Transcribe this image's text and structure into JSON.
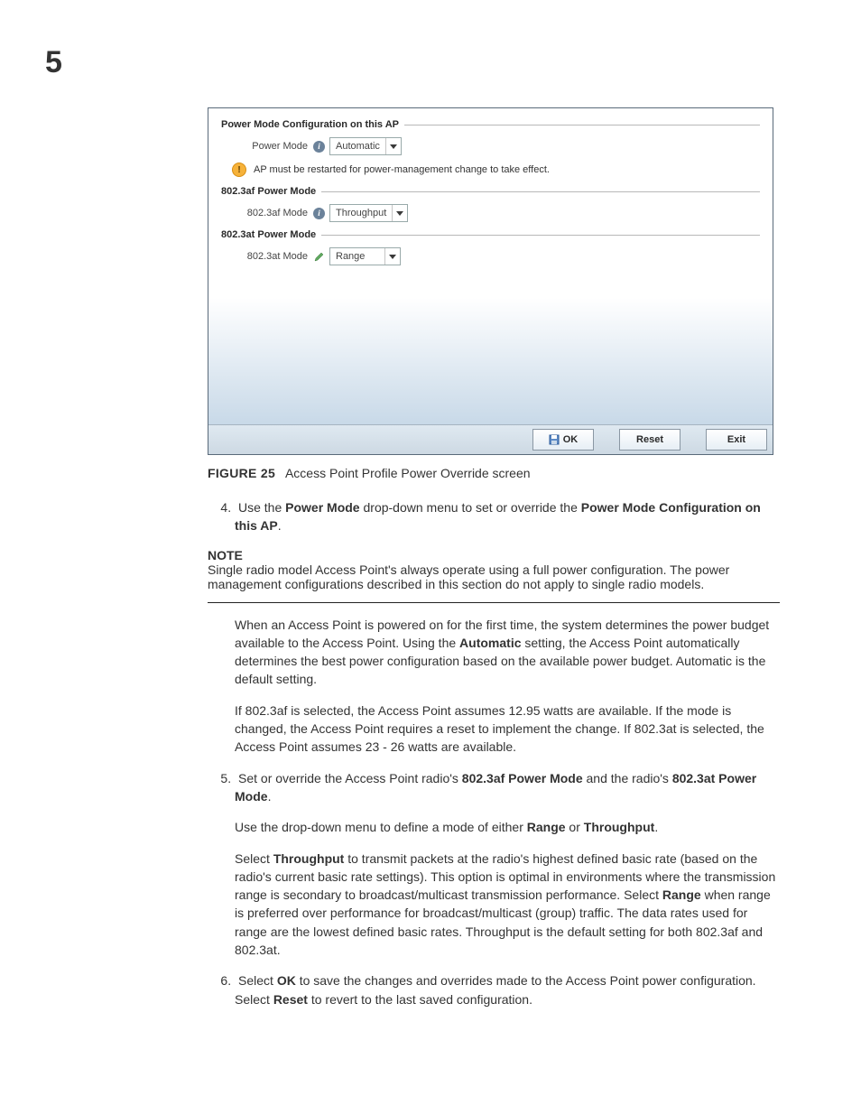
{
  "chapter_number": "5",
  "screenshot": {
    "section1": {
      "title": "Power Mode Configuration on this AP",
      "row_label": "Power Mode",
      "dropdown_value": "Automatic",
      "warning_text": "AP must be restarted for power-management change to take effect."
    },
    "section2": {
      "title": "802.3af Power Mode",
      "row_label": "802.3af Mode",
      "dropdown_value": "Throughput"
    },
    "section3": {
      "title": "802.3at Power Mode",
      "row_label": "802.3at Mode",
      "dropdown_value": "Range"
    },
    "buttons": {
      "ok": "OK",
      "reset": "Reset",
      "exit": "Exit"
    }
  },
  "caption": {
    "label": "FIGURE 25",
    "bold_part": "Access Point",
    "rest": " Profile Power Override screen"
  },
  "step4": {
    "pre": "Use the ",
    "b1": "Power Mode",
    "mid": " drop-down menu to set or override the ",
    "b2": "Power Mode Configuration on this AP",
    "post": "."
  },
  "note": {
    "label": "NOTE",
    "text": "Single radio model Access Point's always operate using a full power configuration. The power management configurations described in this section do not apply to single radio models."
  },
  "para_auto_1": "When an Access Point is powered on for the first time, the system determines the power budget available to the Access Point. Using the ",
  "para_auto_bold": "Automatic",
  "para_auto_2": " setting, the Access Point automatically determines the best power configuration based on the available power budget. Automatic is the default setting.",
  "para_af": "If 802.3af is selected, the Access Point assumes 12.95 watts are available. If the mode is changed, the Access Point requires a reset to implement the change. If 802.3at is selected, the Access Point assumes 23 - 26 watts are available.",
  "step5": {
    "pre": "Set or override the Access Point radio's ",
    "b1": "802.3af Power Mode",
    "mid": " and the radio's ",
    "b2": "802.3at Power Mode",
    "post": "."
  },
  "step5_p1_a": "Use the drop-down menu to define a mode of either ",
  "step5_p1_b1": "Range",
  "step5_p1_mid": " or ",
  "step5_p1_b2": "Throughput",
  "step5_p1_post": ".",
  "step5_p2_a": "Select ",
  "step5_p2_b1": "Throughput",
  "step5_p2_b": " to transmit packets at the radio's highest defined basic rate (based on the radio's current basic rate settings). This option is optimal in environments where the transmission range is secondary to broadcast/multicast transmission performance. Select ",
  "step5_p2_b2": "Range",
  "step5_p2_c": " when range is preferred over performance for broadcast/multicast (group) traffic. The data rates used for range are the lowest defined basic rates. Throughput is the default setting for both 802.3af and 802.3at.",
  "step6": {
    "a": "Select ",
    "b1": "OK",
    "b": " to save the changes and overrides made to the Access Point power configuration. Select ",
    "b2": "Reset",
    "c": " to revert to the last saved configuration."
  }
}
